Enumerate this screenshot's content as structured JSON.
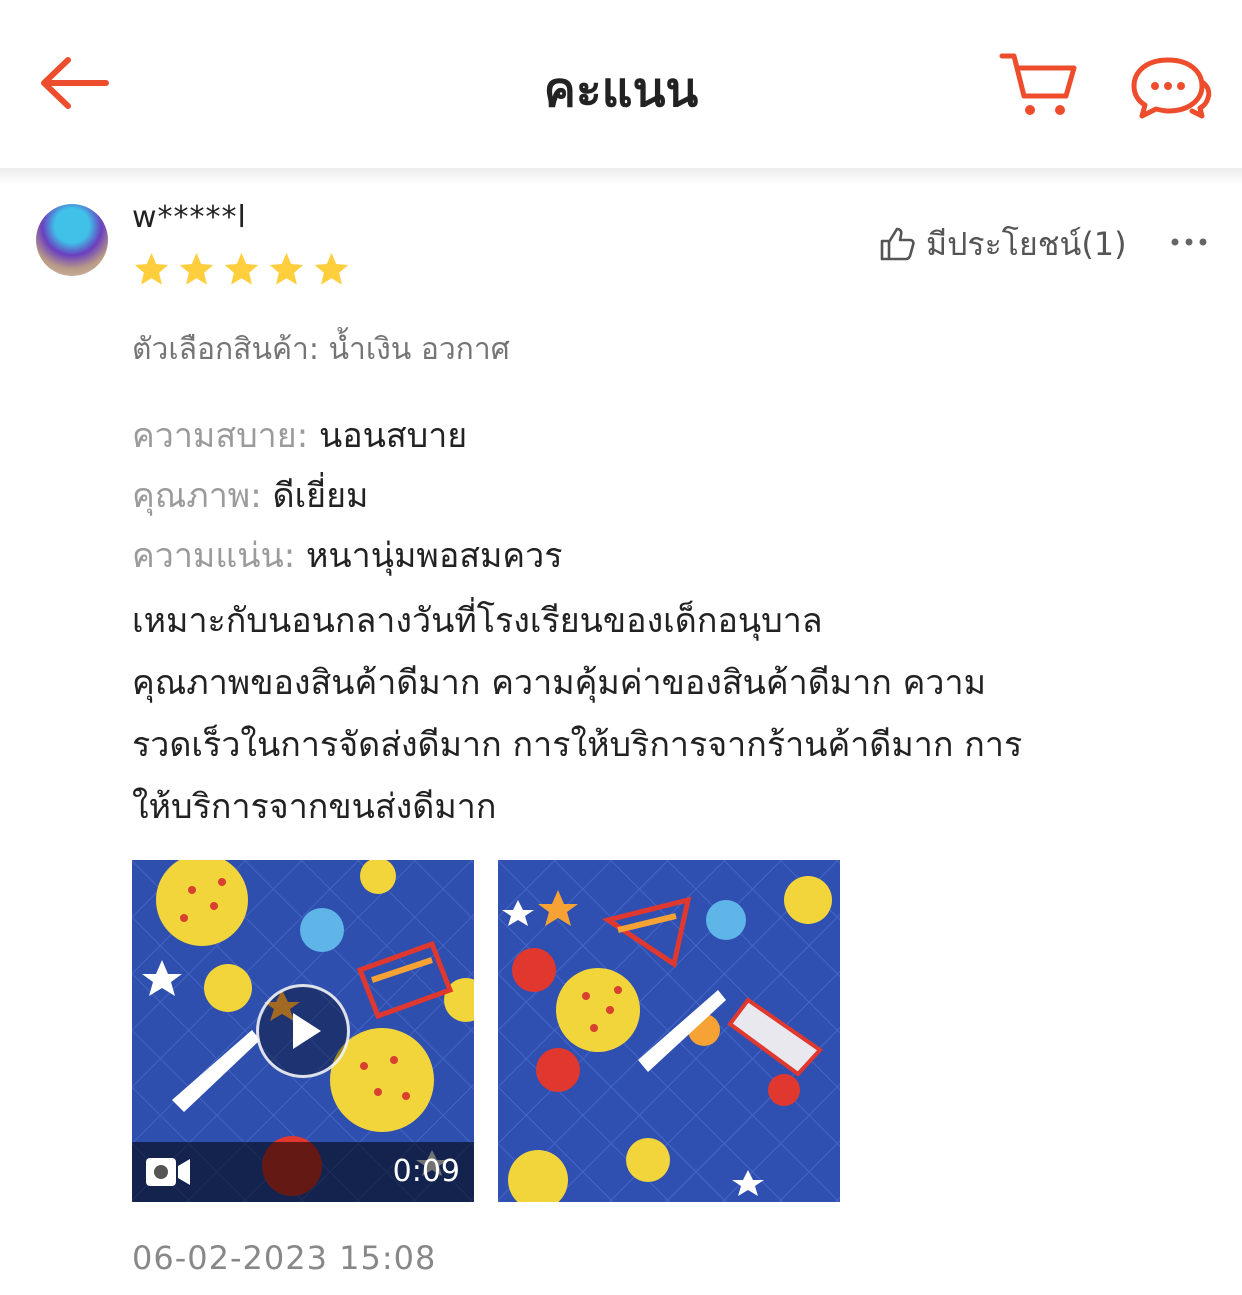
{
  "header": {
    "title": "คะแนน",
    "back_icon": "arrow-left-icon",
    "cart_icon": "cart-icon",
    "chat_icon": "chat-bubbles-icon",
    "accent_color": "#ee4d2d"
  },
  "review": {
    "username": "w*****l",
    "rating": 5,
    "rating_max": 5,
    "star_color": "#ffce3d",
    "helpful_label": "มีประโยชน์(1)",
    "variation": "ตัวเลือกสินค้า: น้ำเงิน อวกาศ",
    "attributes": [
      {
        "label": "ความสบาย:",
        "value": "นอนสบาย"
      },
      {
        "label": "คุณภาพ:",
        "value": "ดีเยี่ยม"
      },
      {
        "label": "ความแน่น:",
        "value": "หนานุ่มพอสมควร"
      }
    ],
    "comment_lines": [
      "เหมาะกับนอนกลางวันที่โรงเรียนของเด็กอนุบาล",
      "คุณภาพของสินค้าดีมาก ความคุ้มค่าของสินค้าดีมาก ความ",
      "รวดเร็วในการจัดส่งดีมาก การให้บริการจากร้านค้าดีมาก การ",
      "ให้บริการจากขนส่งดีมาก"
    ],
    "media": [
      {
        "type": "video",
        "duration": "0:09"
      },
      {
        "type": "image"
      }
    ],
    "timestamp": "06-02-2023 15:08"
  }
}
